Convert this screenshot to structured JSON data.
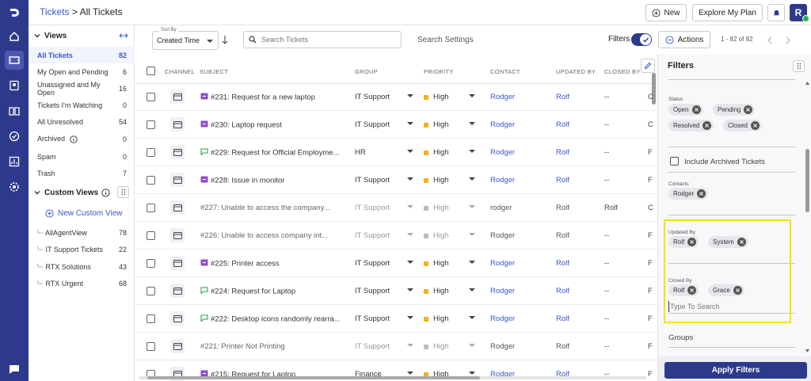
{
  "header": {
    "breadcrumb_link": "Tickets",
    "breadcrumb_sep": ">",
    "breadcrumb_current": "All Tickets",
    "new_label": "New",
    "explore_label": "Explore My Plan",
    "avatar_initial": "R"
  },
  "views": {
    "title": "Views",
    "items": [
      {
        "label": "All Tickets",
        "count": "82"
      },
      {
        "label": "My Open and Pending",
        "count": "6"
      },
      {
        "label": "Unassigned and My Open",
        "count": "16"
      },
      {
        "label": "Tickets I'm Watching",
        "count": "0"
      },
      {
        "label": "All Unresolved",
        "count": "54"
      },
      {
        "label": "Archived",
        "count": "0"
      },
      {
        "label": "Spam",
        "count": "0"
      },
      {
        "label": "Trash",
        "count": "7"
      }
    ],
    "custom_title": "Custom Views",
    "new_custom_label": "New Custom View",
    "custom_items": [
      {
        "label": "AllAgentView",
        "count": "78"
      },
      {
        "label": "IT Support Tickets",
        "count": "22"
      },
      {
        "label": "RTX Solutions",
        "count": "43"
      },
      {
        "label": "RTX Urgent",
        "count": "68"
      }
    ]
  },
  "toolbar": {
    "sort_label": "Sort By",
    "sort_value": "Created Time",
    "search_placeholder": "Search Tickets",
    "search_settings": "Search Settings",
    "filters_label": "Filters",
    "actions_label": "Actions",
    "pagination": "1 - 82 of 82"
  },
  "grid": {
    "headers": {
      "channel": "CHANNEL",
      "subject": "SUBJECT",
      "group": "GROUP",
      "priority": "PRIORITY",
      "contact": "CONTACT",
      "updated_by": "UPDATED BY",
      "closed_by": "CLOSED BY"
    },
    "rows": [
      {
        "subject": "#231: Request for a new laptop",
        "tag": "purple",
        "group": "IT Support",
        "priority": "High",
        "prio_color": "#f2b21b",
        "contact": "Rodger",
        "updated_by": "Rolf",
        "closed_by": "--",
        "edge": "C",
        "resolved": false
      },
      {
        "subject": "#230: Laptop request",
        "tag": "purple",
        "group": "IT Support",
        "priority": "High",
        "prio_color": "#f2b21b",
        "contact": "Rodger",
        "updated_by": "Rolf",
        "closed_by": "--",
        "edge": "C",
        "resolved": false
      },
      {
        "subject": "#229: Request for Official Employme...",
        "tag": "green",
        "group": "HR",
        "priority": "High",
        "prio_color": "#f2b21b",
        "contact": "Rodger",
        "updated_by": "Rolf",
        "closed_by": "--",
        "edge": "F",
        "resolved": false
      },
      {
        "subject": "#228: Issue in monitor",
        "tag": "purple",
        "group": "IT Support",
        "priority": "High",
        "prio_color": "#f2b21b",
        "contact": "Rodger",
        "updated_by": "Rolf",
        "closed_by": "--",
        "edge": "F",
        "resolved": false
      },
      {
        "subject": "#227: Unable to access the company...",
        "tag": "",
        "group": "IT Support",
        "priority": "High",
        "prio_color": "#bdbdbd",
        "contact": "rodger",
        "updated_by": "Rolf",
        "closed_by": "Rolf",
        "edge": "C",
        "resolved": true
      },
      {
        "subject": "#226: Unable to access company int...",
        "tag": "",
        "group": "IT Support",
        "priority": "High",
        "prio_color": "#bdbdbd",
        "contact": "Rodger",
        "updated_by": "Rolf",
        "closed_by": "--",
        "edge": "F",
        "resolved": true
      },
      {
        "subject": "#225: Printer access",
        "tag": "purple",
        "group": "IT Support",
        "priority": "High",
        "prio_color": "#f2b21b",
        "contact": "Rodger",
        "updated_by": "Rolf",
        "closed_by": "--",
        "edge": "F",
        "resolved": false
      },
      {
        "subject": "#224: Request for Laptop",
        "tag": "green",
        "group": "IT Support",
        "priority": "High",
        "prio_color": "#f2b21b",
        "contact": "Rodger",
        "updated_by": "Rolf",
        "closed_by": "--",
        "edge": "F",
        "resolved": false
      },
      {
        "subject": "#222: Desktop icons randomly rearra...",
        "tag": "green",
        "group": "IT Support",
        "priority": "High",
        "prio_color": "#f2b21b",
        "contact": "Rodger",
        "updated_by": "Rolf",
        "closed_by": "--",
        "edge": "F",
        "resolved": false
      },
      {
        "subject": "#221: Printer Not Printing",
        "tag": "",
        "group": "IT Support",
        "priority": "High",
        "prio_color": "#bdbdbd",
        "contact": "Rodger",
        "updated_by": "Rolf",
        "closed_by": "--",
        "edge": "F",
        "resolved": true
      },
      {
        "subject": "#215: Request for Laptop",
        "tag": "purple",
        "group": "Finance",
        "priority": "High",
        "prio_color": "#f2b21b",
        "contact": "Rodger",
        "updated_by": "Rolf",
        "closed_by": "--",
        "edge": "F",
        "resolved": false
      }
    ]
  },
  "filters": {
    "title": "Filters",
    "status_label": "Status",
    "status_chips": [
      "Open",
      "Pending",
      "Resolved",
      "Closed"
    ],
    "include_archived": "Include Archived Tickets",
    "contacts_label": "Contacts",
    "contacts_chips": [
      "Rodger"
    ],
    "updated_by_label": "Updated By",
    "updated_by_chips": [
      "Rolf",
      "System"
    ],
    "closed_by_label": "Closed By",
    "closed_by_chips": [
      "Rolf",
      "Grace"
    ],
    "type_to_search": "Type To Search",
    "groups_label": "Groups",
    "apply_label": "Apply Filters"
  },
  "colors": {
    "brand": "#2d3a8c",
    "link": "#3a58c8",
    "highlight": "#f5e400",
    "tag_purple": "#8e4ec6",
    "tag_green": "#2e9e4f"
  }
}
